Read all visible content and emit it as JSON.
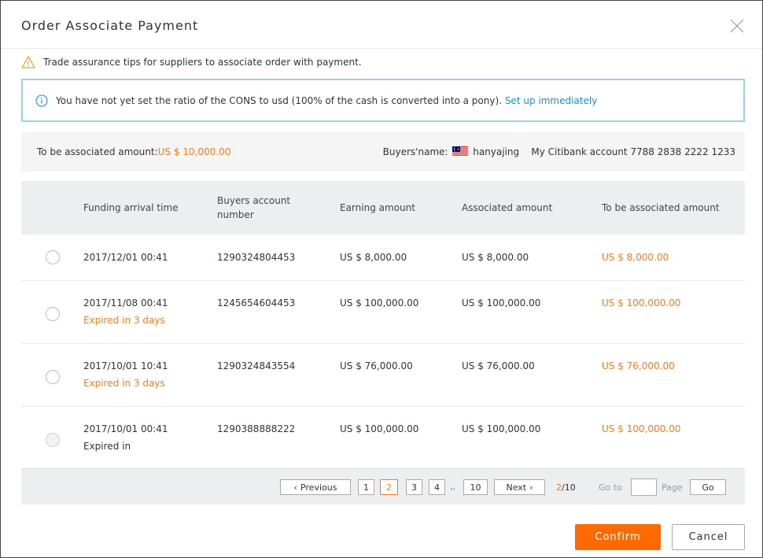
{
  "dialog": {
    "title": "Order Associate Payment",
    "tip": "Trade assurance tips for suppliers to associate order with payment.",
    "info": {
      "text": "You have not yet set the ratio of the CONS to usd (100% of the cash is converted into a pony).",
      "link": "Set up immediately"
    }
  },
  "summary": {
    "to_be_label": "To be associated amount:",
    "to_be_value": "US $ 10,000.00",
    "buyer_label": "Buyers'name:",
    "buyer_name": "hanyajing",
    "account": "My Citibank account 7788 2838 2222 1233"
  },
  "table": {
    "headers": [
      "Funding arrival time",
      "Buyers account number",
      "Earning amount",
      "Associated amount",
      "To be associated amount"
    ],
    "rows": [
      {
        "time": "2017/12/01 00:41",
        "note": "",
        "account": "1290324804453",
        "earning": "US $ 8,000.00",
        "associated": "US $ 8,000.00",
        "to_be": "US $ 8,000.00"
      },
      {
        "time": "2017/11/08 00:41",
        "note": "Expired in 3 days",
        "account": "1245654604453",
        "earning": "US $ 100,000.00",
        "associated": "US $ 100,000.00",
        "to_be": "US $ 100,000.00"
      },
      {
        "time": "2017/10/01 10:41",
        "note": "Expired in 3 days",
        "account": "1290324843554",
        "earning": "US $ 76,000.00",
        "associated": "US $ 76,000.00",
        "to_be": "US $ 76,000.00"
      },
      {
        "time": "2017/10/01 00:41",
        "note": "Expired in",
        "account": "1290388888222",
        "earning": "US $ 100,000.00",
        "associated": "US $ 100,000.00",
        "to_be": "US $ 100,000.00"
      }
    ]
  },
  "pagination": {
    "prev": "Previous",
    "pages": [
      "1",
      "2",
      "3",
      "4"
    ],
    "ellipsis": "..",
    "last": "10",
    "next": "Next",
    "current": "2",
    "total": "/10",
    "goto_label": "Go to",
    "page_label": "Page",
    "go": "Go"
  },
  "actions": {
    "confirm": "Confirm",
    "cancel": "Cancel"
  },
  "colors": {
    "accent": "#ff6a00",
    "highlight": "#f47b20",
    "link": "#1b8fd6",
    "info_border": "#9bd0ec"
  },
  "icons": {
    "close": "close-icon",
    "warning": "warning-icon",
    "info": "info-icon",
    "flag": "malaysia-flag-icon",
    "prev": "chevron-left-icon",
    "next": "chevron-right-icon"
  }
}
